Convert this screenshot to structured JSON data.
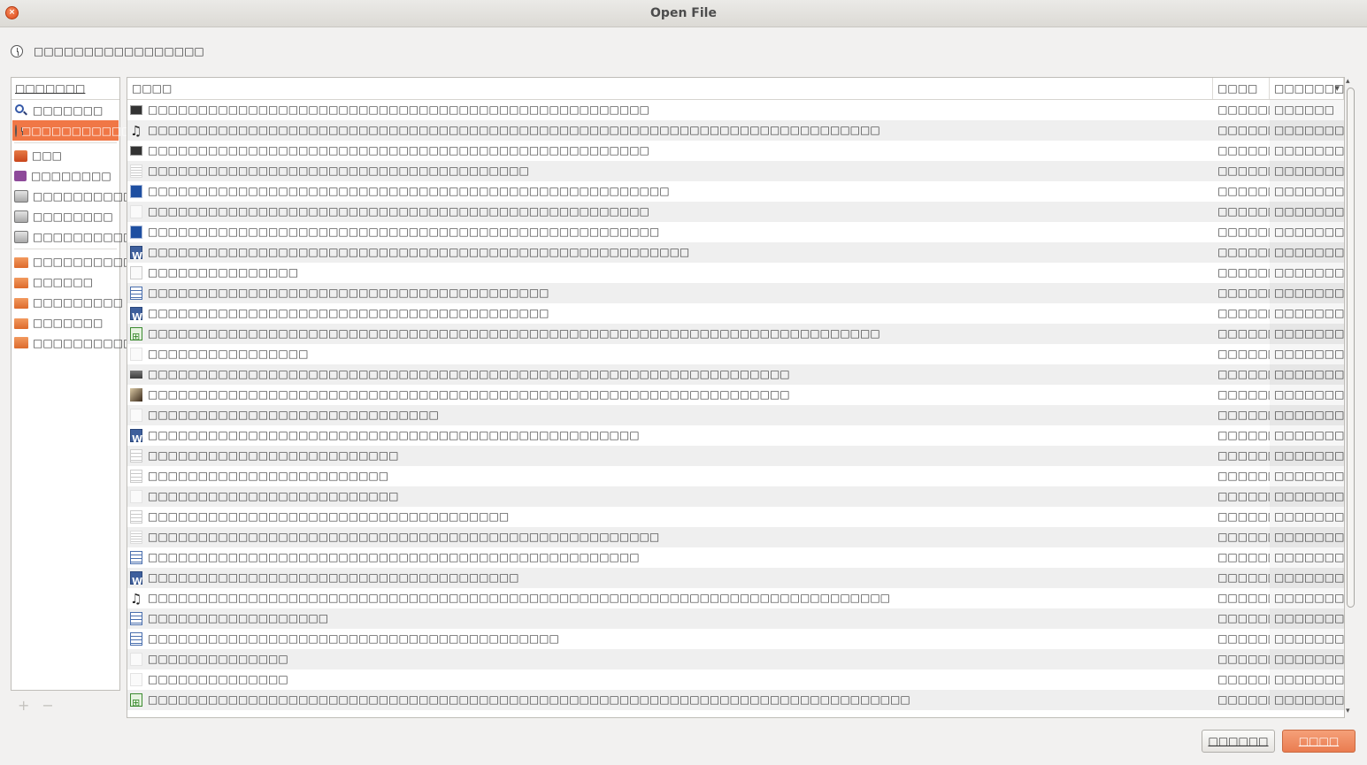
{
  "window": {
    "title": "Open File",
    "close_glyph": "×"
  },
  "location": {
    "label": "□□□□□□□□□□□□□□□□□",
    "icon": "recent-clock-icon"
  },
  "sidebar": {
    "header": "□□□□□□□",
    "items": [
      {
        "label": "□□□□□□□",
        "icon": "search-icon",
        "selected": false
      },
      {
        "label": "□□□□□□□□□□□□□□□□",
        "icon": "recent-clock-icon",
        "selected": true
      },
      {
        "label": "□□□",
        "icon": "home-folder-icon",
        "selected": false
      },
      {
        "label": "□□□□□□□□",
        "icon": "video-icon",
        "selected": false
      },
      {
        "label": "□□□□□□□□□□□□□",
        "icon": "drive-icon",
        "selected": false
      },
      {
        "label": "□□□□□□□□",
        "icon": "drive-icon",
        "selected": false
      },
      {
        "label": "□□□□□□□□□□□□□□□",
        "icon": "drive-icon",
        "selected": false
      },
      {
        "label": "□□□□□□□□□□",
        "icon": "folder-icon",
        "selected": false
      },
      {
        "label": "□□□□□□",
        "icon": "folder-icon",
        "selected": false
      },
      {
        "label": "□□□□□□□□□",
        "icon": "folder-icon",
        "selected": false
      },
      {
        "label": "□□□□□□□",
        "icon": "folder-icon",
        "selected": false
      },
      {
        "label": "□□□□□□□□□□",
        "icon": "pictures-folder-icon",
        "selected": false
      }
    ],
    "add_glyph": "+",
    "remove_glyph": "−"
  },
  "filelist": {
    "headers": {
      "name": "□□□□",
      "size": "□□□□",
      "modified": "□□□□□□□□"
    },
    "rows": [
      {
        "icon": "media-file-icon",
        "name": "□□□□□□□□□□□□□□□□□□□□□□□□□□□□□□□□□□□□□□□□□□□□□□□□□□",
        "size": "□□□□□□□",
        "modified": "□□□□□□"
      },
      {
        "icon": "audio-file-icon",
        "name": "□□□□□□□□□□□□□□□□□□□□□□□□□□□□□□□□□□□□□□□□□□□□□□□□□□□□□□□□□□□□□□□□□□□□□□□□□",
        "size": "□□□□□□□□",
        "modified": "□□□□□□□□□"
      },
      {
        "icon": "media-file-icon",
        "name": "□□□□□□□□□□□□□□□□□□□□□□□□□□□□□□□□□□□□□□□□□□□□□□□□□□",
        "size": "□□□□□□□□",
        "modified": "□□□□□□□□□"
      },
      {
        "icon": "list-file-icon",
        "name": "□□□□□□□□□□□□□□□□□□□□□□□□□□□□□□□□□□□□□□",
        "size": "□□□□□□□",
        "modified": "□□□□□□□"
      },
      {
        "icon": "pdf-file-icon",
        "name": "□□□□□□□□□□□□□□□□□□□□□□□□□□□□□□□□□□□□□□□□□□□□□□□□□□□□",
        "size": "□□□□□□□",
        "modified": "□□□□□□□"
      },
      {
        "icon": "blank-file-icon",
        "name": "□□□□□□□□□□□□□□□□□□□□□□□□□□□□□□□□□□□□□□□□□□□□□□□□□□",
        "size": "□□□□□□□",
        "modified": "□□□□□□□"
      },
      {
        "icon": "pdf-file-icon",
        "name": "□□□□□□□□□□□□□□□□□□□□□□□□□□□□□□□□□□□□□□□□□□□□□□□□□□□",
        "size": "□□□□□□□",
        "modified": "□□□□□□□"
      },
      {
        "icon": "word-file-icon",
        "name": "□□□□□□□□□□□□□□□□□□□□□□□□□□□□□□□□□□□□□□□□□□□□□□□□□□□□□□",
        "size": "□□□□□□□",
        "modified": "□□□□□□□"
      },
      {
        "icon": "signature-file-icon",
        "name": "□□□□□□□□□□□□□□□",
        "size": "□□□□□□□",
        "modified": "□□□□□□□□□□□"
      },
      {
        "icon": "document-file-icon",
        "name": "□□□□□□□□□□□□□□□□□□□□□□□□□□□□□□□□□□□□□□□□",
        "size": "□□□□□□□□",
        "modified": "□□□□□□□□□□□"
      },
      {
        "icon": "word-file-icon",
        "name": "□□□□□□□□□□□□□□□□□□□□□□□□□□□□□□□□□□□□□□□□",
        "size": "□□□□□□□",
        "modified": "□□□□□□□□□□□"
      },
      {
        "icon": "spreadsheet-file-icon",
        "name": "□□□□□□□□□□□□□□□□□□□□□□□□□□□□□□□□□□□□□□□□□□□□□□□□□□□□□□□□□□□□□□□□□□□□□□□□□",
        "size": "□□□□□□□",
        "modified": "□□□□□□□□□□□"
      },
      {
        "icon": "blank-file-icon",
        "name": "□□□□□□□□□□□□□□□□",
        "size": "□□□□□□□",
        "modified": "□□□□□□□□"
      },
      {
        "icon": "image-landscape-icon",
        "name": "□□□□□□□□□□□□□□□□□□□□□□□□□□□□□□□□□□□□□□□□□□□□□□□□□□□□□□□□□□□□□□□□",
        "size": "□□□□□□□□",
        "modified": "□□□□□□□□□"
      },
      {
        "icon": "image-portrait-icon",
        "name": "□□□□□□□□□□□□□□□□□□□□□□□□□□□□□□□□□□□□□□□□□□□□□□□□□□□□□□□□□□□□□□□□",
        "size": "□□□□□□□",
        "modified": "□□□□□□□□□"
      },
      {
        "icon": "blank-file-icon",
        "name": "□□□□□□□□□□□□□□□□□□□□□□□□□□□□□",
        "size": "□□□□□□□",
        "modified": "□□□□□□□□□"
      },
      {
        "icon": "word-file-icon",
        "name": "□□□□□□□□□□□□□□□□□□□□□□□□□□□□□□□□□□□□□□□□□□□□□□□□□",
        "size": "□□□□□□□",
        "modified": "□□□□□□□□□"
      },
      {
        "icon": "text-file-icon",
        "name": "□□□□□□□□□□□□□□□□□□□□□□□□□",
        "size": "□□□□□□□□",
        "modified": "□□□□□□□□□"
      },
      {
        "icon": "text-file-icon",
        "name": "□□□□□□□□□□□□□□□□□□□□□□□□",
        "size": "□□□□□□□",
        "modified": "□□□□□□□□□"
      },
      {
        "icon": "blank-file-icon",
        "name": "□□□□□□□□□□□□□□□□□□□□□□□□□",
        "size": "□□□□□□□□",
        "modified": "□□□□□□□□□"
      },
      {
        "icon": "text-file-icon",
        "name": "□□□□□□□□□□□□□□□□□□□□□□□□□□□□□□□□□□□□",
        "size": "□□□□□□□",
        "modified": "□□□□□□□□□"
      },
      {
        "icon": "list-file-icon",
        "name": "□□□□□□□□□□□□□□□□□□□□□□□□□□□□□□□□□□□□□□□□□□□□□□□□□□□",
        "size": "□□□□□□□",
        "modified": "□□□□□□□□□"
      },
      {
        "icon": "document-file-icon",
        "name": "□□□□□□□□□□□□□□□□□□□□□□□□□□□□□□□□□□□□□□□□□□□□□□□□□",
        "size": "□□□□□□□",
        "modified": "□□□□□□□□□"
      },
      {
        "icon": "word-file-icon",
        "name": "□□□□□□□□□□□□□□□□□□□□□□□□□□□□□□□□□□□□□",
        "size": "□□□□□□□",
        "modified": "□□□□□□□□□"
      },
      {
        "icon": "audio-file-icon",
        "name": "□□□□□□□□□□□□□□□□□□□□□□□□□□□□□□□□□□□□□□□□□□□□□□□□□□□□□□□□□□□□□□□□□□□□□□□□□□",
        "size": "□□□□□□□□",
        "modified": "□□□□□□□□□"
      },
      {
        "icon": "document-file-icon",
        "name": "□□□□□□□□□□□□□□□□□□",
        "size": "□□□□□□□",
        "modified": "□□□□□□□□□"
      },
      {
        "icon": "document-file-icon",
        "name": "□□□□□□□□□□□□□□□□□□□□□□□□□□□□□□□□□□□□□□□□□",
        "size": "□□□□□□□",
        "modified": "□□□□□□□□□"
      },
      {
        "icon": "blank-file-icon",
        "name": "□□□□□□□□□□□□□□",
        "size": "□□□□□□□",
        "modified": "□□□□□□□□□"
      },
      {
        "icon": "blank-file-icon",
        "name": "□□□□□□□□□□□□□□",
        "size": "□□□□□□□",
        "modified": "□□□□□□□□□"
      },
      {
        "icon": "spreadsheet-file-icon",
        "name": "□□□□□□□□□□□□□□□□□□□□□□□□□□□□□□□□□□□□□□□□□□□□□□□□□□□□□□□□□□□□□□□□□□□□□□□□□□□□",
        "size": "□□□□□□□",
        "modified": "□□□□□□□□□"
      }
    ]
  },
  "buttons": {
    "cancel": "□□□□□□",
    "open": "□□□□"
  }
}
